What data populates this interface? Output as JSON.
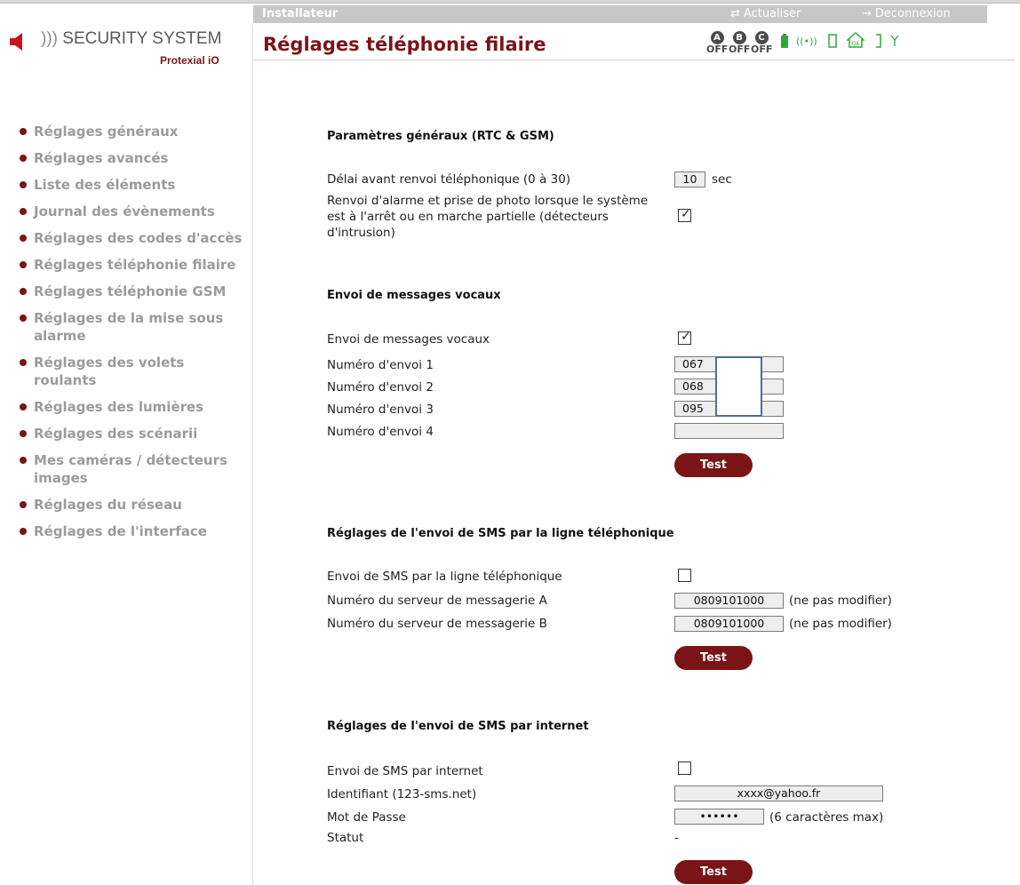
{
  "topbar": {
    "role": "Installateur",
    "refresh_label": "Actualiser",
    "logout_label": "Deconnexion"
  },
  "logo": {
    "name": "SECURITY SYSTEM",
    "product": "Protexial iO"
  },
  "page_title": "Réglages téléphonie filaire",
  "status_zones": [
    {
      "letter": "A",
      "state": "OFF"
    },
    {
      "letter": "B",
      "state": "OFF"
    },
    {
      "letter": "C",
      "state": "OFF"
    }
  ],
  "status_icons": [
    "battery-icon",
    "radio-waves-icon",
    "door-icon",
    "home-ok-icon",
    "phone-line-icon",
    "antenna-icon"
  ],
  "nav": {
    "items": [
      "Réglages généraux",
      "Réglages avancés",
      "Liste des éléments",
      "Journal des évènements",
      "Réglages des codes d'accès",
      "Réglages téléphonie filaire",
      "Réglages téléphonie GSM",
      "Réglages de la mise sous alarme",
      "Réglages des volets roulants",
      "Réglages des lumières",
      "Réglages des scénarii",
      "Mes caméras / détecteurs images",
      "Réglages du réseau",
      "Réglages de l'interface"
    ]
  },
  "general": {
    "title": "Paramètres généraux (RTC & GSM)",
    "delay_label": "Délai avant renvoi téléphonique (0 à 30)",
    "delay_value": "10",
    "delay_unit": "sec",
    "alarm_forward_label": "Renvoi d'alarme et prise de photo lorsque le système est à l'arrêt ou en marche partielle (détecteurs d'intrusion)",
    "alarm_forward_checked": true
  },
  "voice": {
    "title": "Envoi de messages vocaux",
    "enable_label": "Envoi de messages vocaux",
    "enable_checked": true,
    "numbers": [
      {
        "label": "Numéro d'envoi 1",
        "value": "067"
      },
      {
        "label": "Numéro d'envoi 2",
        "value": "068"
      },
      {
        "label": "Numéro d'envoi 3",
        "value": "095"
      },
      {
        "label": "Numéro d'envoi 4",
        "value": ""
      }
    ],
    "test_label": "Test"
  },
  "sms_line": {
    "title": "Réglages de l'envoi de SMS par la ligne téléphonique",
    "enable_label": "Envoi de SMS par la ligne téléphonique",
    "enable_checked": false,
    "server_a_label": "Numéro du serveur de messagerie A",
    "server_a_value": "0809101000",
    "server_b_label": "Numéro du serveur de messagerie B",
    "server_b_value": "0809101000",
    "note": "(ne pas modifier)",
    "test_label": "Test"
  },
  "sms_internet": {
    "title": "Réglages de l'envoi de SMS par internet",
    "enable_label": "Envoi de SMS par internet",
    "enable_checked": false,
    "id_label": "Identifiant (123-sms.net)",
    "id_value": "xxxx@yahoo.fr",
    "password_label": "Mot de Passe",
    "password_value": "••••••",
    "password_note": "(6 caractères max)",
    "status_label": "Statut",
    "status_value": "-",
    "test_label": "Test"
  }
}
